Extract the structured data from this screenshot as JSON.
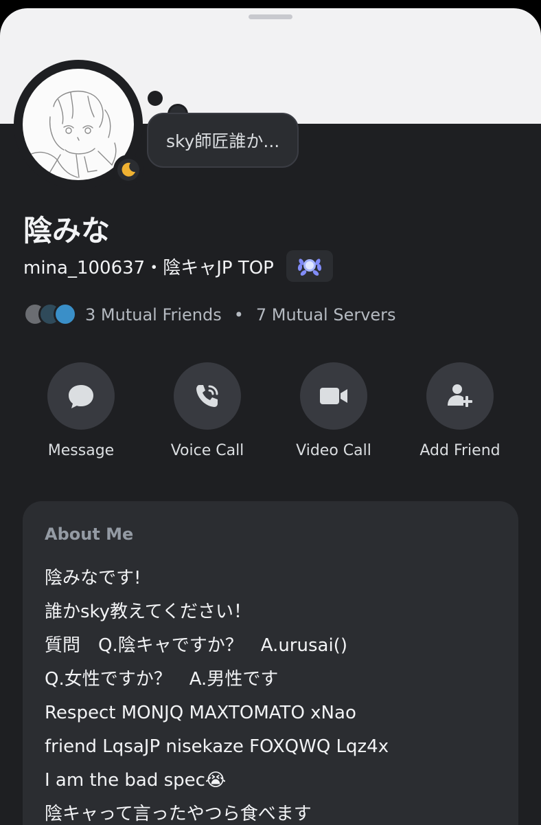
{
  "status_message": "sky師匠誰か...",
  "profile": {
    "display_name": "陰みな",
    "username_line": "mina_100637・陰キャJP TOP",
    "badge_icon": "laurel-badge-icon",
    "status": "idle"
  },
  "mutuals": {
    "friends": "3 Mutual Friends",
    "separator": "•",
    "servers": "7 Mutual Servers"
  },
  "actions": [
    {
      "label": "Message",
      "icon": "chat-bubble-icon"
    },
    {
      "label": "Voice Call",
      "icon": "phone-icon"
    },
    {
      "label": "Video Call",
      "icon": "video-camera-icon"
    },
    {
      "label": "Add Friend",
      "icon": "add-friend-icon"
    }
  ],
  "about": {
    "title": "About Me",
    "lines": [
      "陰みなです!",
      "誰かsky教えてください！",
      "質問　Q.陰キャですか？　A.urusai()",
      "Q.女性ですか？　A.男性です",
      "Respect MONJQ MAXTOMATO xNao",
      "friend LqsaJP nisekaze FOXQWQ Lqz4x",
      "I am the bad spec😭",
      "陰キャって言ったやつら食べます"
    ]
  },
  "colors": {
    "background": "#1e1f22",
    "banner": "#f2f2f3",
    "card": "#2b2d31",
    "button": "#383a40",
    "idle": "#f0b232"
  }
}
